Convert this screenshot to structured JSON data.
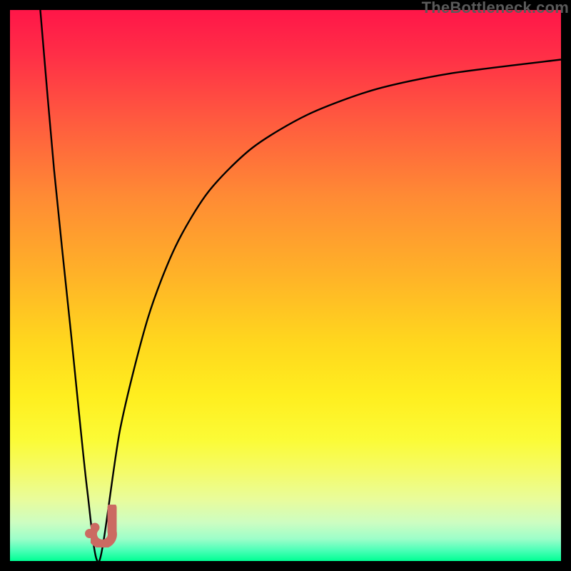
{
  "attribution": "TheBottleneck.com",
  "colors": {
    "marker": "#cb6a62",
    "curve": "#000000"
  },
  "chart_data": {
    "type": "line",
    "title": "",
    "xlabel": "",
    "ylabel": "",
    "xlim": [
      0,
      100
    ],
    "ylim": [
      0,
      100
    ],
    "grid": false,
    "legend": false,
    "annotations": [
      "J"
    ],
    "series": [
      {
        "name": "left-branch",
        "x": [
          5.5,
          8,
          11,
          14,
          16.2
        ],
        "y": [
          100,
          71,
          42,
          13,
          0
        ]
      },
      {
        "name": "right-branch",
        "x": [
          16.2,
          20,
          25,
          30,
          36,
          44,
          54,
          66,
          80,
          100
        ],
        "y": [
          0,
          24,
          44,
          57,
          67,
          75,
          81,
          85.5,
          88.5,
          91
        ]
      }
    ],
    "marker": {
      "x": 17,
      "y": 3.5,
      "label": "J"
    },
    "marker_dot": {
      "x": 14.5,
      "y": 5
    },
    "gradient_stops": [
      {
        "pos": 0.0,
        "color": "#ff1648"
      },
      {
        "pos": 0.08,
        "color": "#ff2e47"
      },
      {
        "pos": 0.2,
        "color": "#ff5a3f"
      },
      {
        "pos": 0.34,
        "color": "#ff8b34"
      },
      {
        "pos": 0.48,
        "color": "#ffb228"
      },
      {
        "pos": 0.6,
        "color": "#ffd61e"
      },
      {
        "pos": 0.7,
        "color": "#ffee1f"
      },
      {
        "pos": 0.78,
        "color": "#fbfb36"
      },
      {
        "pos": 0.84,
        "color": "#f4fb6b"
      },
      {
        "pos": 0.89,
        "color": "#e8fc9d"
      },
      {
        "pos": 0.93,
        "color": "#cdfdc1"
      },
      {
        "pos": 0.96,
        "color": "#9cfec9"
      },
      {
        "pos": 0.98,
        "color": "#4effb8"
      },
      {
        "pos": 1.0,
        "color": "#00ff94"
      }
    ]
  }
}
